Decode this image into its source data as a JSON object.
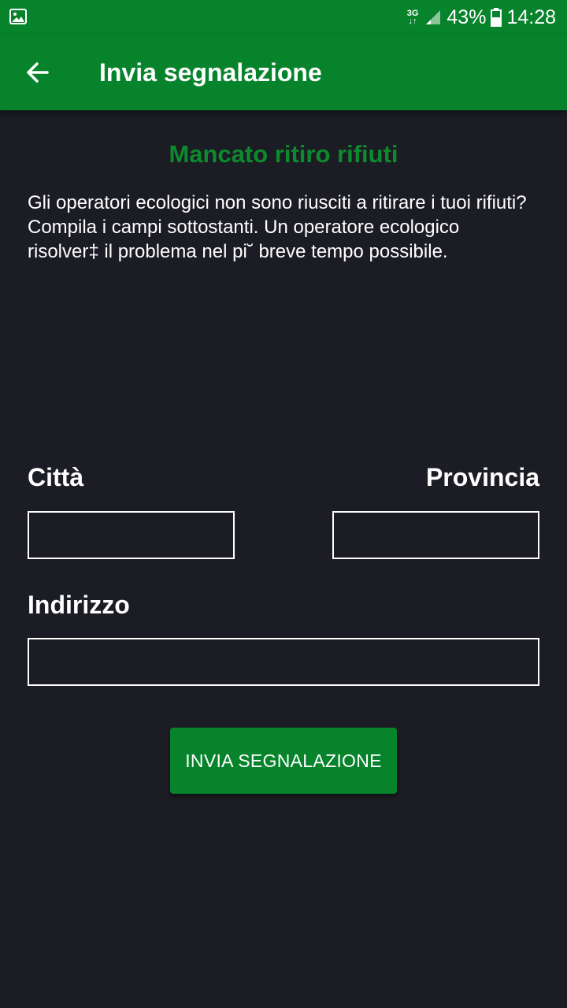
{
  "status_bar": {
    "network_type": "3G",
    "battery": "43%",
    "time": "14:28",
    "icons": [
      "gallery-icon",
      "data-arrows-icon",
      "signal-icon",
      "battery-icon"
    ]
  },
  "app_bar": {
    "back_icon": "arrow-left-icon",
    "title": "Invia segnalazione"
  },
  "content": {
    "heading": "Mancato ritiro rifiuti",
    "description": "Gli operatori ecologici non sono riusciti a ritirare i tuoi rifiuti? Compila i campi sottostanti. Un operatore ecologico risolver‡ il problema nel pi˘ breve tempo possibile."
  },
  "form": {
    "citta_label": "Città",
    "citta_value": "",
    "provincia_label": "Provincia",
    "provincia_value": "",
    "indirizzo_label": "Indirizzo",
    "indirizzo_value": "",
    "submit_label": "INVIA SEGNALAZIONE"
  },
  "colors": {
    "primary": "#06832b",
    "heading": "#0d8a2e",
    "background": "#1b1c24",
    "text": "#ffffff"
  }
}
